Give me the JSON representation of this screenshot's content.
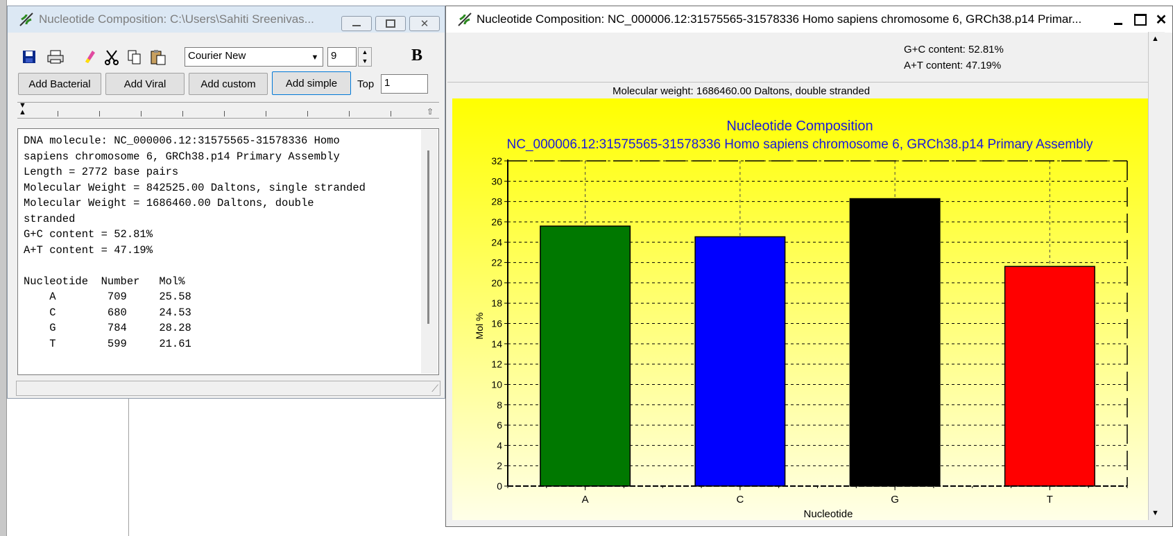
{
  "left_window": {
    "title": "Nucleotide Composition: C:\\Users\\Sahiti Sreenivas...",
    "toolbar": {
      "font_name": "Courier New",
      "font_size": "9",
      "bold_label": "B"
    },
    "buttons": {
      "add_bacterial": "Add Bacterial",
      "add_viral": "Add Viral",
      "add_custom": "Add custom",
      "add_simple": "Add simple",
      "top_label": "Top",
      "top_value": "1"
    },
    "report_lines": [
      "DNA molecule: NC_000006.12:31575565-31578336 Homo",
      "sapiens chromosome 6, GRCh38.p14 Primary Assembly",
      "Length = 2772 base pairs",
      "Molecular Weight = 842525.00 Daltons, single stranded",
      "Molecular Weight = 1686460.00 Daltons, double",
      "stranded",
      "G+C content = 52.81%",
      "A+T content = 47.19%",
      "",
      "Nucleotide  Number   Mol%",
      "    A        709     25.58",
      "    C        680     24.53",
      "    G        784     28.28",
      "    T        599     21.61"
    ]
  },
  "right_window": {
    "title": "Nucleotide Composition: NC_000006.12:31575565-31578336 Homo sapiens chromosome 6, GRCh38.p14 Primar...",
    "gc_content": "G+C content: 52.81%",
    "at_content": "A+T content: 47.19%",
    "molecular_weight": "Molecular weight: 1686460.00 Daltons, double stranded"
  },
  "colors": {
    "plot_bg_top": "#ffff00",
    "plot_bg_bottom": "#ffffe8",
    "title_color": "#1a1ad8"
  },
  "chart_data": {
    "type": "bar",
    "title": "Nucleotide Composition",
    "subtitle": "NC_000006.12:31575565-31578336 Homo sapiens chromosome 6, GRCh38.p14 Primary Assembly",
    "xlabel": "Nucleotide",
    "ylabel": "Mol %",
    "categories": [
      "A",
      "C",
      "G",
      "T"
    ],
    "values": [
      25.58,
      24.53,
      28.28,
      21.61
    ],
    "bar_colors": [
      "#007800",
      "#0000ff",
      "#000000",
      "#ff0000"
    ],
    "ylim": [
      0,
      32
    ],
    "yticks": [
      0,
      2,
      4,
      6,
      8,
      10,
      12,
      14,
      16,
      18,
      20,
      22,
      24,
      26,
      28,
      30,
      32
    ],
    "grid": true
  }
}
